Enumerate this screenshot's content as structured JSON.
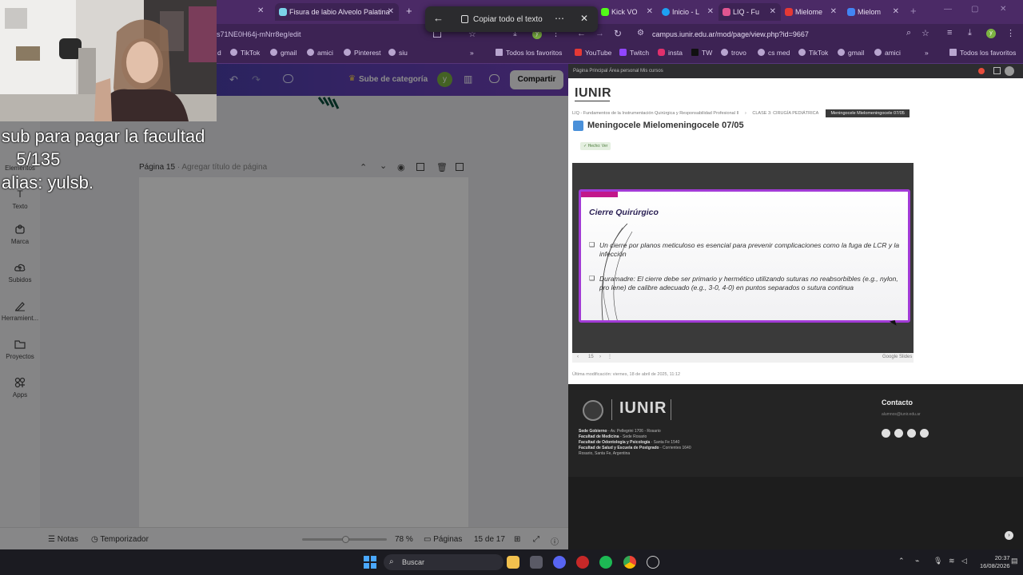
{
  "left_browser": {
    "tabs": [
      {
        "label": "Fisura de labio Alveolo Palatina"
      }
    ],
    "url": "s71NE0H64j-mNrr8eg/edit",
    "bookmarks": [
      "d",
      "TikTok",
      "gmail",
      "amici",
      "Pinterest",
      "siu",
      "Todos los favoritos"
    ],
    "canva": {
      "category_label": "Sube de categoría",
      "avatar_letter": "y",
      "share_label": "Compartir",
      "sidebar": [
        "Elementos",
        "Texto",
        "Marca",
        "Subidos",
        "Herramient...",
        "Proyectos",
        "Apps"
      ],
      "page_number_label": "Página 15",
      "page_title_placeholder": "Agregar título de página",
      "bottom": {
        "notes": "Notas",
        "timer": "Temporizador",
        "zoom": "78 %",
        "pages_label": "Páginas",
        "page_count": "15 de 17"
      }
    }
  },
  "popup": {
    "copy_label": "Copiar todo el texto"
  },
  "right_browser": {
    "tabs": [
      {
        "label": "Kick VO"
      },
      {
        "label": "Inicio - L"
      },
      {
        "label": "LIQ - Fu"
      },
      {
        "label": "Mielome"
      },
      {
        "label": "Mielom"
      }
    ],
    "url": "campus.iunir.edu.ar/mod/page/view.php?id=9667",
    "bookmarks": [
      "YouTube",
      "Twitch",
      "insta",
      "TW",
      "trovo",
      "cs med",
      "TikTok",
      "gmail",
      "amici",
      "Todos los favoritos"
    ],
    "site": {
      "top_nav": "Página Principal   Área personal   Mis cursos",
      "logo": "IUNIR",
      "breadcrumb_1": "LIQ - Fundamentos de la Instrumentación Quirúrgica y Responsabilidad Profesional II",
      "breadcrumb_2": "CLASE 3: CIRUGÍA PEDIÁTRICA",
      "breadcrumb_3": "Meningocele Mielomeningocele 07/05",
      "page_title": "Meningocele Mielomeningocele 07/05",
      "badge": "✓ Hecho: Ver",
      "slide": {
        "title": "Cierre Quirúrgico",
        "bullets": [
          "Un cierre por planos meticuloso es esencial para prevenir complicaciones como la fuga de LCR y la infección",
          "Duramadre: El cierre debe ser primario y hermético utilizando suturas no reabsorbibles (e.g., nylon, pro lene) de calibre adecuado (e.g., 3-0, 4-0) en puntos separados o sutura continua"
        ],
        "page": "15",
        "provider": "Google Slides"
      },
      "last_modified": "Última modificación: viernes, 18 de abril de 2025, 11:12",
      "footer": {
        "brand": "IUNIR",
        "contact_title": "Contacto",
        "contact_email": "alumnos@iunir.edu.ar",
        "lines": [
          {
            "label": "Sede Gobierno",
            "value": "- Av. Pellegrini 1706 - Rosario"
          },
          {
            "label": "Facultad de Medicina",
            "value": "- Sede Rosario"
          },
          {
            "label": "Facultad de Odontología y Psicología",
            "value": "- Santa Fe 1540"
          },
          {
            "label": "Facultad de Salud y Escuela de Postgrado",
            "value": "- Corrientes 1640"
          },
          {
            "label": "",
            "value": "Rosario, Santa Fe, Argentina"
          }
        ]
      }
    }
  },
  "stream_overlay": {
    "line1": "sub para pagar la facultad",
    "line2": "   5/135",
    "line3": "alias: yulsb."
  },
  "taskbar": {
    "search_placeholder": "Buscar",
    "time": "20:37",
    "date": "16/08/2026"
  },
  "colors": {
    "browser_chrome": "#4b2a66",
    "canva_gradient_start": "#2f3e9c",
    "canva_gradient_end": "#7141b8",
    "slide_border": "#a23bd6",
    "slide_accent": "#c2178a"
  }
}
